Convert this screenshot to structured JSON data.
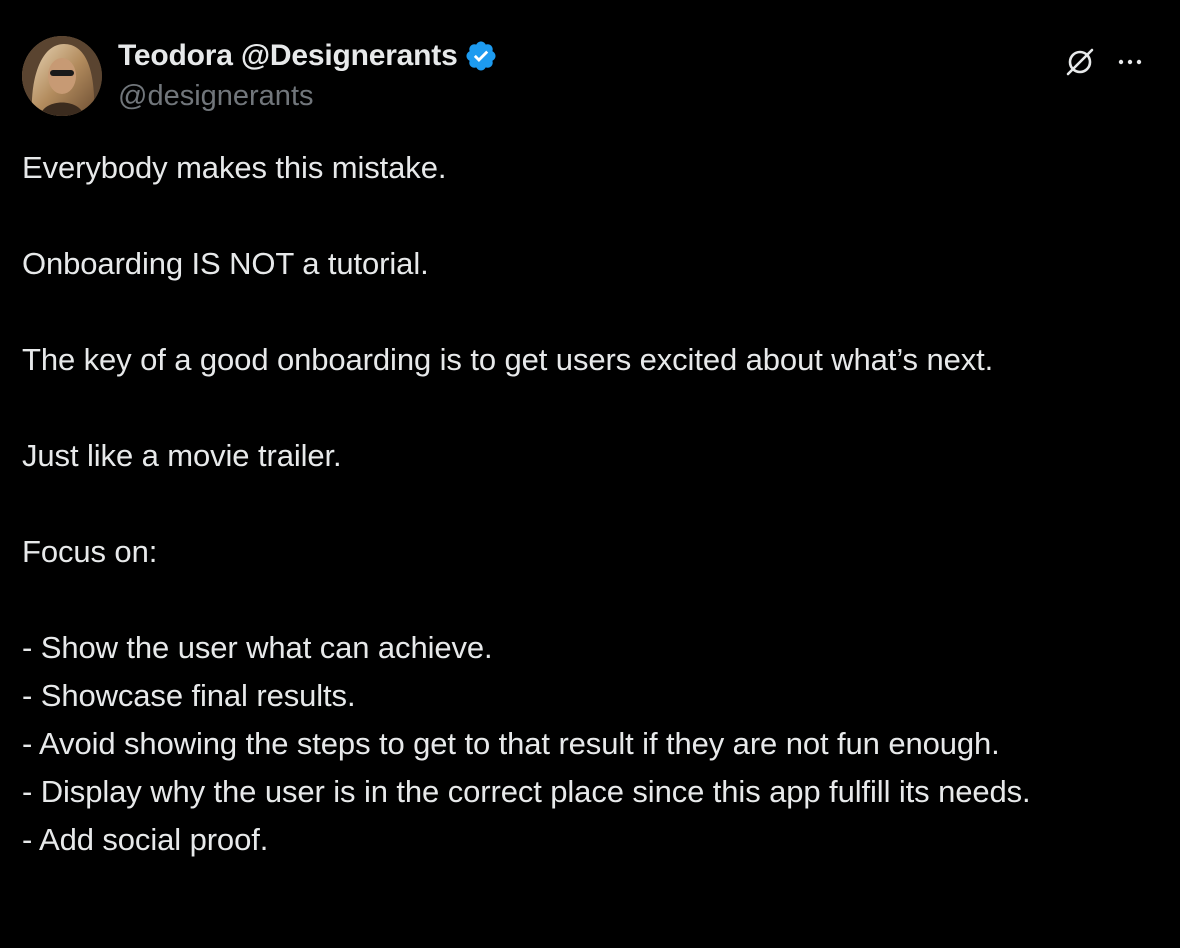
{
  "author": {
    "display_name": "Teodora @Designerants",
    "handle": "@designerants",
    "verified": true,
    "verified_color": "#1d9bf0"
  },
  "icons": {
    "brand": "grok-icon",
    "more": "more-options-icon",
    "verified": "verified-badge-icon"
  },
  "post": {
    "line1": "Everybody makes this mistake.",
    "line2": "Onboarding IS NOT a tutorial.",
    "line3": "The key of a good onboarding is to get users excited about what’s next.",
    "line4": "Just like a movie trailer.",
    "line5": "Focus on:",
    "bullets": [
      "- Show the user what can achieve.",
      "- Showcase final results.",
      "- Avoid showing the steps to get to that result if they are not fun enough.",
      "- Display why the user is in the correct place since this app fulfill its needs.",
      "- Add social proof."
    ]
  },
  "colors": {
    "background": "#000000",
    "primary_text": "#e7e9ea",
    "secondary_text": "#71767b"
  }
}
